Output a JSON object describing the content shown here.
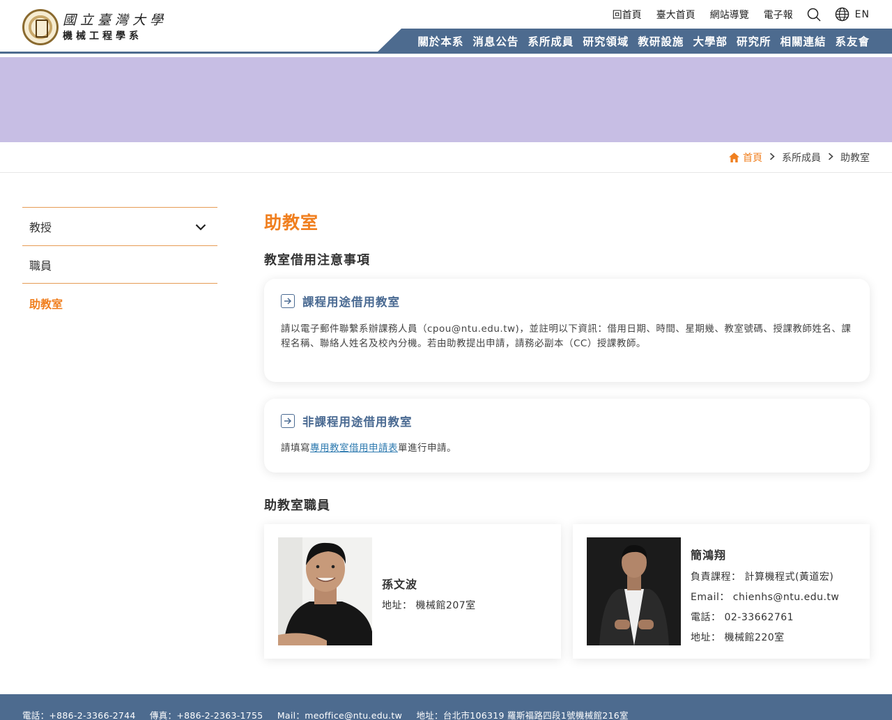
{
  "header": {
    "logo_line1": "國立臺灣大學",
    "logo_line2": "機械工程學系",
    "util_links": [
      "回首頁",
      "臺大首頁",
      "網站導覽",
      "電子報"
    ],
    "lang": "EN",
    "nav": [
      "關於本系",
      "消息公告",
      "系所成員",
      "研究領域",
      "教研設施",
      "大學部",
      "研究所",
      "相關連結",
      "系友會"
    ]
  },
  "breadcrumb": {
    "home": "首頁",
    "level1": "系所成員",
    "current": "助教室"
  },
  "sidebar": {
    "items": [
      {
        "label": "教授"
      },
      {
        "label": "職員"
      },
      {
        "label": "助教室"
      }
    ]
  },
  "main": {
    "title": "助教室",
    "notice_title": "教室借用注意事項",
    "cards": [
      {
        "title": "課程用途借用教室",
        "body": "請以電子郵件聯繫系辦課務人員（cpou@ntu.edu.tw)，並註明以下資訊：借用日期、時間、星期幾、教室號碼、授課教師姓名、課程名稱、聯絡人姓名及校內分機。若由助教提出申請，請務必副本（CC）授課教師。"
      },
      {
        "title": "非課程用途借用教室",
        "body_pre": "請填寫",
        "body_link": "專用教室借用申請表",
        "body_post": "單進行申請。"
      }
    ],
    "staff_title": "助教室職員",
    "staff": [
      {
        "name": "孫文波",
        "address_label": "地址：",
        "address": "機械館207室"
      },
      {
        "name": "簡鴻翔",
        "course_label": "負責課程：",
        "course": "計算機程式(黃道宏)",
        "email_label": "Email：",
        "email": "chienhs@ntu.edu.tw",
        "phone_label": "電話：",
        "phone": "02-33662761",
        "address_label": "地址：",
        "address": "機械館220室"
      }
    ]
  },
  "footer": {
    "phone": "電話：+886-2-3366-2744",
    "fax": "傳真：+886-2-2363-1755",
    "mail": "Mail：meoffice@ntu.edu.tw",
    "address": "地址：台北市106319 羅斯福路四段1號機械館216室"
  }
}
